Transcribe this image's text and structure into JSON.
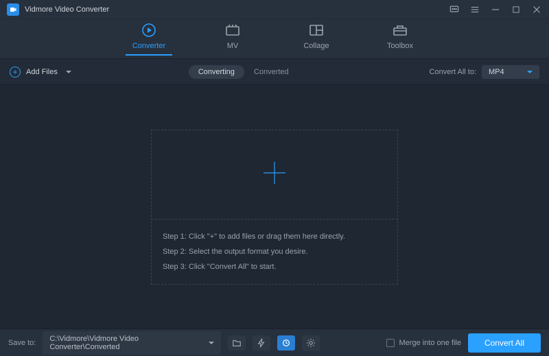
{
  "titlebar": {
    "title": "Vidmore Video Converter"
  },
  "tabs": {
    "converter": "Converter",
    "mv": "MV",
    "collage": "Collage",
    "toolbox": "Toolbox"
  },
  "toolbar": {
    "add_files": "Add Files",
    "pill_converting": "Converting",
    "pill_converted": "Converted",
    "convert_all_to_label": "Convert All to:",
    "format_selected": "MP4"
  },
  "dropzone": {
    "step1": "Step 1: Click \"+\" to add files or drag them here directly.",
    "step2": "Step 2: Select the output format you desire.",
    "step3": "Step 3: Click \"Convert All\" to start."
  },
  "bottombar": {
    "save_to_label": "Save to:",
    "path": "C:\\Vidmore\\Vidmore Video Converter\\Converted",
    "merge_label": "Merge into one file",
    "convert_all": "Convert All"
  }
}
